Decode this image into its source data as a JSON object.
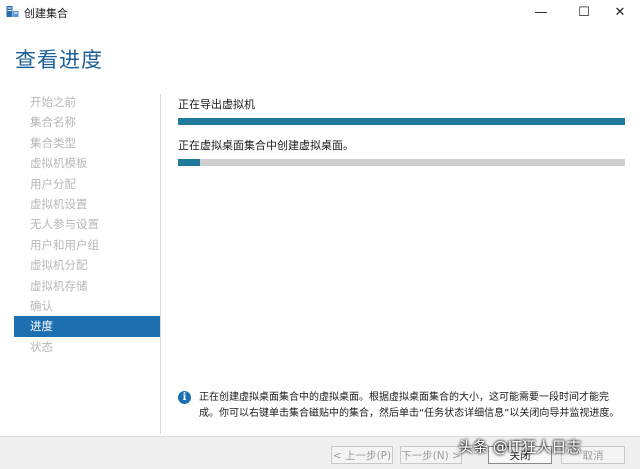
{
  "window": {
    "title": "创建集合",
    "controls": {
      "minimize": "—",
      "maximize": "☐",
      "close": "✕"
    }
  },
  "page_title": "查看进度",
  "nav": {
    "items": [
      "开始之前",
      "集合名称",
      "集合类型",
      "虚拟机模板",
      "用户分配",
      "虚拟机设置",
      "无人参与设置",
      "用户和用户组",
      "虚拟机分配",
      "虚拟机存储",
      "确认",
      "进度",
      "状态"
    ],
    "active_index": 11
  },
  "tasks": [
    {
      "label": "正在导出虚拟机",
      "progress": 1.0
    },
    {
      "label": "正在虚拟桌面集合中创建虚拟桌面。",
      "progress": 0.05
    }
  ],
  "info": {
    "icon": "info-icon",
    "text": "正在创建虚拟桌面集合中的虚拟桌面。根据虚拟桌面集合的大小，这可能需要一段时间才能完成。你可以右键单击集合磁贴中的集合，然后单击“任务状态详细信息”以关闭向导并监视进度。"
  },
  "footer": {
    "prev": "< 上一步(P)",
    "next": "下一步(N) >",
    "close": "关闭",
    "cancel": "取消"
  },
  "watermark": "头条 @IT狂人日志",
  "colors": {
    "accent": "#1e6fb0",
    "progress": "#1f7a9c",
    "track": "#cfcfcf",
    "disabled_text": "#b8b8b8"
  }
}
